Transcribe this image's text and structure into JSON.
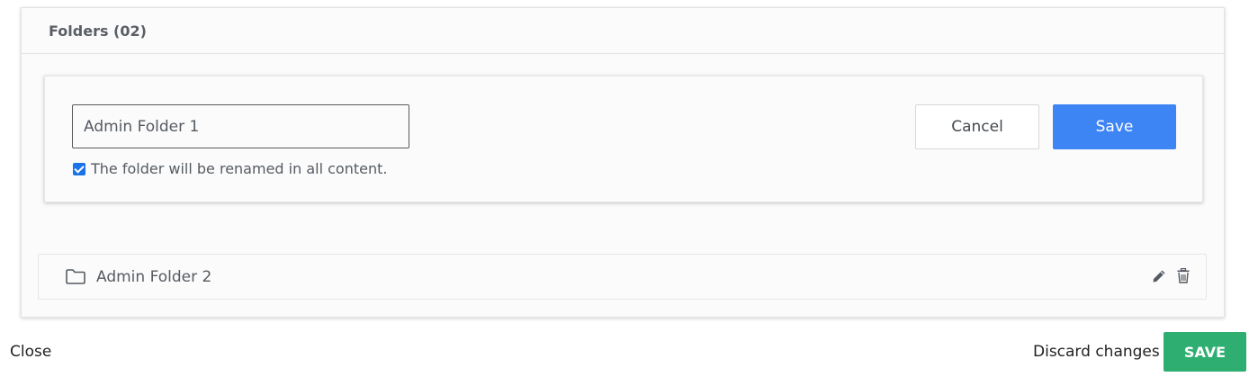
{
  "panel": {
    "title": "Folders (02)"
  },
  "edit_card": {
    "input_value": "Admin Folder 1",
    "checkbox_checked": true,
    "checkbox_label": "The folder will be renamed in all content.",
    "cancel_label": "Cancel",
    "save_label": "Save"
  },
  "folders": [
    {
      "name": "Admin Folder 2",
      "icon": "folder-icon"
    }
  ],
  "footer": {
    "close_label": "Close",
    "discard_label": "Discard changes",
    "save_label": "SAVE"
  },
  "colors": {
    "primary_blue": "#3d84f5",
    "save_green": "#2fae72",
    "checkbox_blue": "#1a73e8"
  }
}
